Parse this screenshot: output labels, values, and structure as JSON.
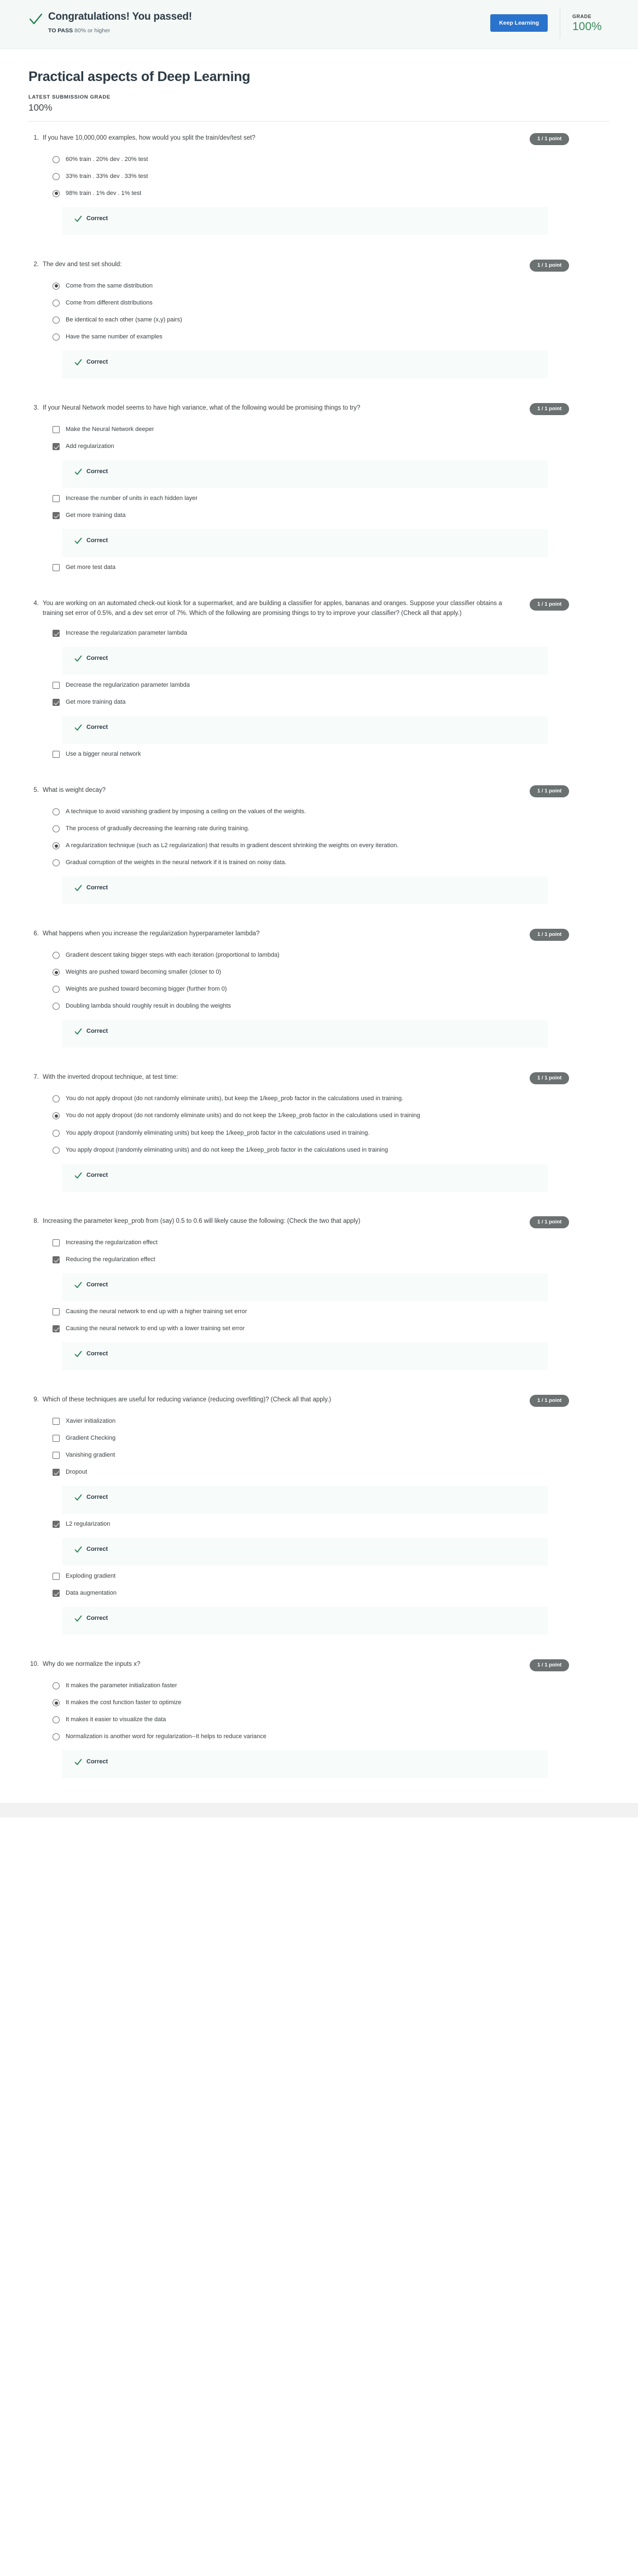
{
  "banner": {
    "check_icon": "check-icon",
    "title": "Congratulations! You passed!",
    "to_pass_label": "TO PASS",
    "to_pass_value": "80% or higher",
    "keep_learning_label": "Keep Learning",
    "grade_label": "GRADE",
    "grade_value": "100%",
    "accent_button_color": "#2a73cc",
    "grade_color": "#3c8c5c",
    "background_color": "#f4f9f7"
  },
  "page": {
    "quiz_title": "Practical aspects of Deep Learning",
    "submission_label": "LATEST SUBMISSION GRADE",
    "submission_grade": "100%"
  },
  "feedback": {
    "correct_label": "Correct",
    "check_icon": "check-icon",
    "background_color": "#f7fbf9",
    "check_color": "#1f7a4d"
  },
  "badge_color": "#6b7070",
  "questions": [
    {
      "number": "1.",
      "text": "If you have 10,000,000 examples, how would you split the train/dev/test set?",
      "points": "1 / 1 point",
      "type": "radio",
      "options": [
        {
          "label": "60% train . 20% dev . 20% test",
          "selected": false,
          "feedback": null
        },
        {
          "label": "33% train . 33% dev . 33% test",
          "selected": false,
          "feedback": null
        },
        {
          "label": "98% train . 1% dev . 1% test",
          "selected": true,
          "feedback": null
        }
      ],
      "feedback": "Correct"
    },
    {
      "number": "2.",
      "text": "The dev and test set should:",
      "points": "1 / 1 point",
      "type": "radio",
      "options": [
        {
          "label": "Come from the same distribution",
          "selected": true,
          "feedback": null
        },
        {
          "label": "Come from different distributions",
          "selected": false,
          "feedback": null
        },
        {
          "label": "Be identical to each other (same (x,y) pairs)",
          "selected": false,
          "feedback": null
        },
        {
          "label": "Have the same number of examples",
          "selected": false,
          "feedback": null
        }
      ],
      "feedback": "Correct"
    },
    {
      "number": "3.",
      "text": "If your Neural Network model seems to have high variance, what of the following would be promising things to try?",
      "points": "1 / 1 point",
      "type": "checkbox",
      "options": [
        {
          "label": "Make the Neural Network deeper",
          "selected": false,
          "feedback": null
        },
        {
          "label": "Add regularization",
          "selected": true,
          "feedback": "Correct"
        },
        {
          "label": "Increase the number of units in each hidden layer",
          "selected": false,
          "feedback": null
        },
        {
          "label": "Get more training data",
          "selected": true,
          "feedback": "Correct"
        },
        {
          "label": "Get more test data",
          "selected": false,
          "feedback": null
        }
      ],
      "feedback": null
    },
    {
      "number": "4.",
      "text": "You are working on an automated check-out kiosk for a supermarket, and are building a classifier for apples, bananas and oranges. Suppose your classifier obtains a training set error of 0.5%, and a dev set error of 7%. Which of the following are promising things to try to improve your classifier? (Check all that apply.)",
      "points": "1 / 1 point",
      "type": "checkbox",
      "options": [
        {
          "label": "Increase the regularization parameter lambda",
          "selected": true,
          "feedback": "Correct"
        },
        {
          "label": "Decrease the regularization parameter lambda",
          "selected": false,
          "feedback": null
        },
        {
          "label": "Get more training data",
          "selected": true,
          "feedback": "Correct"
        },
        {
          "label": "Use a bigger neural network",
          "selected": false,
          "feedback": null
        }
      ],
      "feedback": null
    },
    {
      "number": "5.",
      "text": "What is weight decay?",
      "points": "1 / 1 point",
      "type": "radio",
      "options": [
        {
          "label": "A technique to avoid vanishing gradient by imposing a ceiling on the values of the weights.",
          "selected": false,
          "feedback": null
        },
        {
          "label": "The process of gradually decreasing the learning rate during training.",
          "selected": false,
          "feedback": null
        },
        {
          "label": "A regularization technique (such as L2 regularization) that results in gradient descent shrinking the weights on every iteration.",
          "selected": true,
          "feedback": null
        },
        {
          "label": "Gradual corruption of the weights in the neural network if it is trained on noisy data.",
          "selected": false,
          "feedback": null
        }
      ],
      "feedback": "Correct"
    },
    {
      "number": "6.",
      "text": "What happens when you increase the regularization hyperparameter lambda?",
      "points": "1 / 1 point",
      "type": "radio",
      "options": [
        {
          "label": "Gradient descent taking bigger steps with each iteration (proportional to lambda)",
          "selected": false,
          "feedback": null
        },
        {
          "label": "Weights are pushed toward becoming smaller (closer to 0)",
          "selected": true,
          "feedback": null
        },
        {
          "label": "Weights are pushed toward becoming bigger (further from 0)",
          "selected": false,
          "feedback": null
        },
        {
          "label": "Doubling lambda should roughly result in doubling the weights",
          "selected": false,
          "feedback": null
        }
      ],
      "feedback": "Correct"
    },
    {
      "number": "7.",
      "text": "With the inverted dropout technique, at test time:",
      "points": "1 / 1 point",
      "type": "radio",
      "options": [
        {
          "label": "You do not apply dropout (do not randomly eliminate units), but keep the 1/keep_prob factor in the calculations used in training.",
          "selected": false,
          "feedback": null
        },
        {
          "label": "You do not apply dropout (do not randomly eliminate units) and do not keep the 1/keep_prob factor in the calculations used in training",
          "selected": true,
          "feedback": null
        },
        {
          "label": "You apply dropout (randomly eliminating units) but keep the 1/keep_prob factor in the calculations used in training.",
          "selected": false,
          "feedback": null
        },
        {
          "label": "You apply dropout (randomly eliminating units) and do not keep the 1/keep_prob factor in the calculations used in training",
          "selected": false,
          "feedback": null
        }
      ],
      "feedback": "Correct"
    },
    {
      "number": "8.",
      "text": "Increasing the parameter keep_prob from (say) 0.5 to 0.6 will likely cause the following: (Check the two that apply)",
      "points": "1 / 1 point",
      "type": "checkbox",
      "options": [
        {
          "label": "Increasing the regularization effect",
          "selected": false,
          "feedback": null
        },
        {
          "label": "Reducing the regularization effect",
          "selected": true,
          "feedback": "Correct"
        },
        {
          "label": "Causing the neural network to end up with a higher training set error",
          "selected": false,
          "feedback": null
        },
        {
          "label": "Causing the neural network to end up with a lower training set error",
          "selected": true,
          "feedback": "Correct"
        }
      ],
      "feedback": null
    },
    {
      "number": "9.",
      "text": "Which of these techniques are useful for reducing variance (reducing overfitting)? (Check all that apply.)",
      "points": "1 / 1 point",
      "type": "checkbox",
      "options": [
        {
          "label": "Xavier initialization",
          "selected": false,
          "feedback": null
        },
        {
          "label": "Gradient Checking",
          "selected": false,
          "feedback": null
        },
        {
          "label": "Vanishing gradient",
          "selected": false,
          "feedback": null
        },
        {
          "label": "Dropout",
          "selected": true,
          "feedback": "Correct"
        },
        {
          "label": "L2 regularization",
          "selected": true,
          "feedback": "Correct"
        },
        {
          "label": "Exploding gradient",
          "selected": false,
          "feedback": null
        },
        {
          "label": "Data augmentation",
          "selected": true,
          "feedback": "Correct"
        }
      ],
      "feedback": null
    },
    {
      "number": "10.",
      "text": "Why do we normalize the inputs x?",
      "points": "1 / 1 point",
      "type": "radio",
      "options": [
        {
          "label": "It makes the parameter initialization faster",
          "selected": false,
          "feedback": null
        },
        {
          "label": "It makes the cost function faster to optimize",
          "selected": true,
          "feedback": null
        },
        {
          "label": "It makes it easier to visualize the data",
          "selected": false,
          "feedback": null
        },
        {
          "label": "Normalization is another word for regularization--It helps to reduce variance",
          "selected": false,
          "feedback": null
        }
      ],
      "feedback": "Correct"
    }
  ]
}
